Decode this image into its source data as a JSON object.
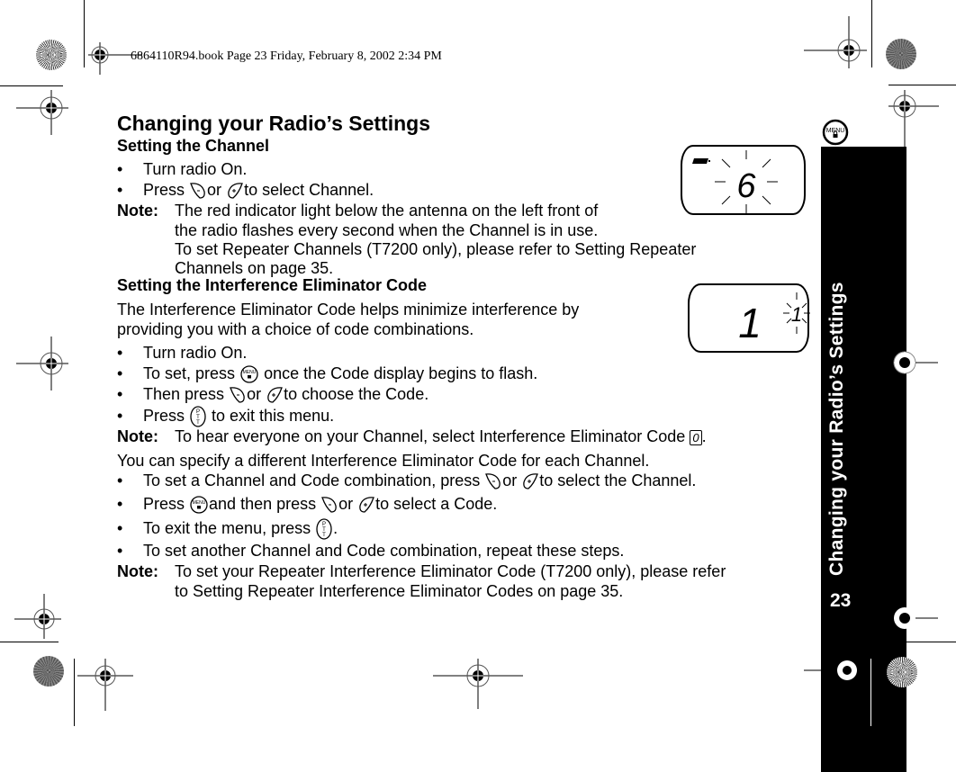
{
  "print_header": "6864110R94.book  Page 23  Friday, February 8, 2002  2:34 PM",
  "page_title": "Changing your Radio’s Settings",
  "sidebar": {
    "title": "Changing your Radio’s Settings",
    "page_number": "23",
    "tab_icon": "menu-lock-icon",
    "tab_icon_label": "MENU"
  },
  "section_channel": {
    "heading": "Setting the Channel",
    "bullets": [
      {
        "text": "Turn radio On."
      },
      {
        "prefix": "Press",
        "middle": "or",
        "suffix": "to select Channel.",
        "icons": [
          "scroll-down-button-icon",
          "scroll-up-button-icon"
        ]
      }
    ],
    "note_label": "Note:",
    "note_lines": [
      "The red indicator light below the antenna on the left front of",
      "the radio flashes every second when the Channel is in use.",
      "To set Repeater Channels (T7200 only), please refer to Setting Repeater",
      "Channels on page 35."
    ],
    "display": {
      "digit": "6",
      "flashing": true,
      "battery_icon": "battery-icon"
    }
  },
  "section_code": {
    "heading": "Setting the Interference Eliminator Code",
    "intro_lines": [
      "The Interference Eliminator Code helps minimize interference by",
      "providing you with a choice of code combinations."
    ],
    "bullets": [
      {
        "text": "Turn radio On."
      },
      {
        "prefix": "To set, press",
        "suffix": " once the Code display begins to flash.",
        "icons": [
          "menu-button-icon"
        ]
      },
      {
        "prefix": "Then press",
        "middle": "or",
        "suffix": "to choose the Code.",
        "icons": [
          "scroll-down-button-icon",
          "scroll-up-button-icon"
        ]
      },
      {
        "prefix": "Press",
        "suffix": " to exit this menu.",
        "icons": [
          "ptt-button-icon"
        ]
      }
    ],
    "note_label": "Note:",
    "note_text": "To hear everyone on your Channel, select Interference Eliminator Code",
    "note_code": "0",
    "display": {
      "channel_digit": "1",
      "code_digit": "1",
      "code_flashing": true
    }
  },
  "section_combo": {
    "intro": "You can specify a different Interference Eliminator Code for each Channel.",
    "bullets": [
      {
        "prefix": "To set a Channel and Code combination, press",
        "middle": "or",
        "suffix": "to select the Channel."
      },
      {
        "prefix": "Press",
        "middle1": "and then press",
        "middle2": "or",
        "suffix": "to select a Code."
      },
      {
        "prefix": "To exit the menu, press",
        "suffix": "."
      },
      {
        "text": "To set another Channel and Code combination, repeat these steps."
      }
    ],
    "note_label": "Note:",
    "note_lines": [
      "To set your Repeater Interference Eliminator Code (T7200 only), please refer",
      "to  Setting Repeater Interference Eliminator Codes on page 35."
    ]
  },
  "bullet_char": "•"
}
